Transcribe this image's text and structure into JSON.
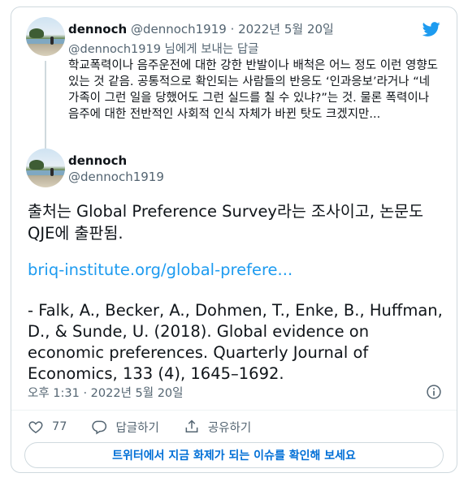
{
  "quoted_tweet": {
    "name": "dennoch",
    "handle_date": "@dennoch1919 · 2022년 5월 20일",
    "reply_to_mention": "@dennoch1919",
    "reply_to_suffix": " 님에게 보내는 답글",
    "text": "학교폭력이나 음주운전에 대한 강한 반발이나 배척은 어느 정도 이런 영향도 있는 것 같음. 공통적으로 확인되는 사람들의 반응도 ‘인과응보’라거나 “네 가족이 그런 일을 당했어도 그런 실드를 칠 수 있냐?”는 것. 물론 폭력이나 음주에 대한 전반적인 사회적 인식 자체가 바뀐 탓도 크겠지만..."
  },
  "main_tweet": {
    "name": "dennoch",
    "handle": "@dennoch1919",
    "text": "출처는 Global Preference Survey라는 조사이고, 논문도 QJE에 출판됨.",
    "link": "briq-institute.org/global-prefere...",
    "citation": "- Falk, A., Becker, A., Dohmen, T., Enke, B., Huffman, D., & Sunde, U. (2018). Global evidence on economic preferences. Quarterly Journal of Economics, 133 (4), 1645–1692.",
    "timestamp": "오후 1:31 · 2022년 5월 20일"
  },
  "actions": {
    "like_count": "77",
    "reply_label": "답글하기",
    "share_label": "공유하기"
  },
  "cta_label": "트위터에서 지금 화제가 되는 이슈를 확인해 보세요",
  "icons": {
    "brand": "twitter-bird-icon",
    "info": "info-icon",
    "like": "heart-icon",
    "reply": "speech-bubble-icon",
    "share": "share-icon"
  },
  "colors": {
    "accent": "#1d9bf0",
    "muted": "#536471",
    "cta_text": "#006fd6",
    "border": "#cfd9de"
  }
}
